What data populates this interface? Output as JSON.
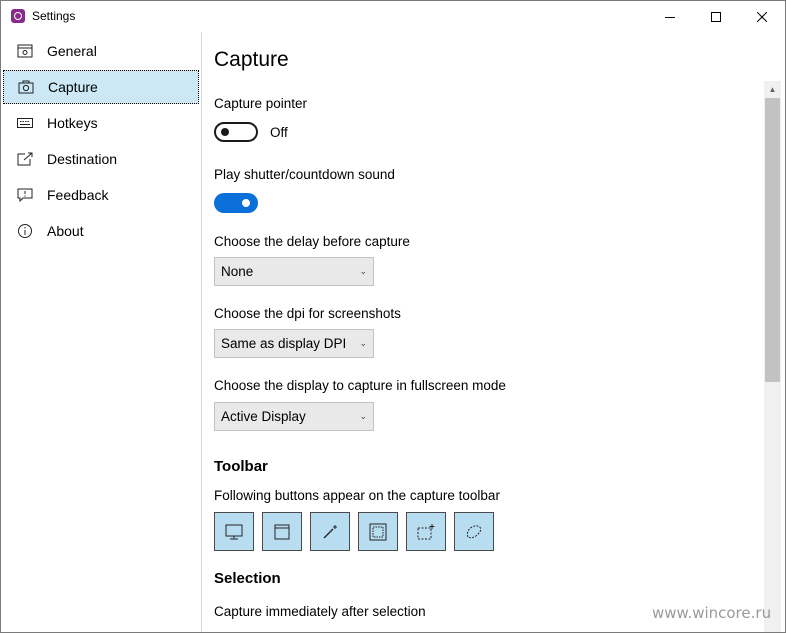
{
  "window": {
    "title": "Settings",
    "controls": {
      "minimize_icon": "minimize-icon",
      "maximize_icon": "maximize-icon",
      "close_icon": "close-icon"
    }
  },
  "sidebar": {
    "items": [
      {
        "label": "General",
        "icon": "general-icon",
        "active": false
      },
      {
        "label": "Capture",
        "icon": "camera-icon",
        "active": true
      },
      {
        "label": "Hotkeys",
        "icon": "keyboard-icon",
        "active": false
      },
      {
        "label": "Destination",
        "icon": "destination-icon",
        "active": false
      },
      {
        "label": "Feedback",
        "icon": "feedback-icon",
        "active": false
      },
      {
        "label": "About",
        "icon": "info-icon",
        "active": false
      }
    ]
  },
  "main": {
    "title": "Capture",
    "capture_pointer": {
      "label": "Capture pointer",
      "state": "Off",
      "on": false
    },
    "shutter_sound": {
      "label": "Play shutter/countdown sound",
      "on": true
    },
    "delay": {
      "label": "Choose the delay before capture",
      "value": "None"
    },
    "dpi": {
      "label": "Choose the dpi for screenshots",
      "value": "Same as display DPI"
    },
    "display": {
      "label": "Choose the display to capture in fullscreen mode",
      "value": "Active Display"
    },
    "toolbar": {
      "heading": "Toolbar",
      "description": "Following buttons appear on the capture toolbar",
      "buttons": [
        "fullscreen-capture-icon",
        "window-capture-icon",
        "magic-wand-icon",
        "region-capture-icon",
        "rectangle-selection-icon",
        "freeform-selection-icon"
      ]
    },
    "selection": {
      "heading": "Selection",
      "capture_immediately_label": "Capture immediately after selection"
    }
  },
  "watermark": "www.wincore.ru",
  "colors": {
    "accent": "#0a6fd8",
    "active_nav": "#cce8f6",
    "toolbar_button": "#b9ddf0"
  }
}
